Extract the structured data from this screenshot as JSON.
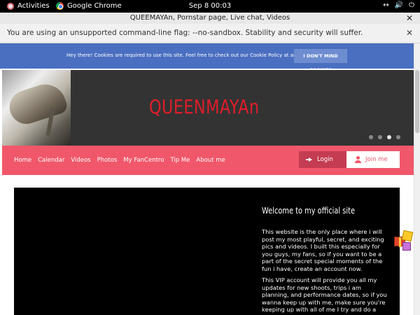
{
  "system_bar": {
    "activities": "Activities",
    "app_name": "Google Chrome",
    "clock": "Sep 8  00:03"
  },
  "window": {
    "title": "QUEEMAYAn, Pornstar page, Live chat, Videos"
  },
  "infobar": {
    "message": "You are using an unsupported command-line flag: --no-sandbox. Stability and security will suffer."
  },
  "cookie_banner": {
    "text": "Hey there! Cookies are required to use this site. Feel free to check out our Cookie Policy at any time.",
    "button": "I DON'T MIND COOKIES"
  },
  "header": {
    "brand": "QUEENMAYAn",
    "slide_dots": 4,
    "active_slide": 3
  },
  "nav": {
    "items": [
      "Home",
      "Calendar",
      "Videos",
      "Photos",
      "My FanCentro",
      "Tip Me",
      "About me"
    ],
    "login": "Login",
    "join": "Join me"
  },
  "content": {
    "welcome": "Welcome to my official site",
    "paragraph1": "This website is the only place where i will post my most playful, secret, and exciting pics and videos. I built this especially for you guys, my fans, so if you want to be a part of the secret special moments of the fun i have, create an account now.",
    "paragraph2": "This VIP account will provide you all my updates for new shoots, trips i am planning, and performance dates, so if you wanna keep up with me, make sure you're keeping up with all of me I try and do a little something special for my new fans, so expect some exclusive live"
  },
  "colors": {
    "cookie_bg": "#4a6fc1",
    "nav_bg": "#f0576a",
    "brand_red": "#e01d2a",
    "header_bg": "#333333"
  }
}
